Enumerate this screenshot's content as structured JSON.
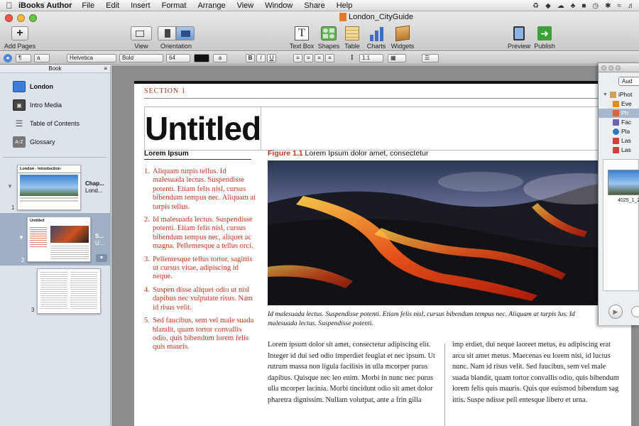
{
  "menubar": {
    "app_name": "iBooks Author",
    "items": [
      "File",
      "Edit",
      "Insert",
      "Format",
      "Arrange",
      "View",
      "Window",
      "Share",
      "Help"
    ]
  },
  "window": {
    "title": "London_CityGuide"
  },
  "toolbar": {
    "add_pages": "Add Pages",
    "view": "View",
    "orientation": "Orientation",
    "text_box": "Text Box",
    "shapes": "Shapes",
    "table": "Table",
    "charts": "Charts",
    "widgets": "Widgets",
    "preview": "Preview",
    "publish": "Publish"
  },
  "formatbar": {
    "paragraph_style": "¶",
    "char_style": "a",
    "font_family": "Helvetica",
    "font_weight": "Bold",
    "font_size": "64",
    "text_color": "#111111",
    "char_btn": "a",
    "bold": "B",
    "italic": "I",
    "underline": "U",
    "line_spacing": "1.1"
  },
  "sidebar": {
    "header": "Book",
    "items": [
      {
        "label": "London",
        "icon": "book-icon"
      },
      {
        "label": "Intro Media",
        "icon": "film-icon"
      },
      {
        "label": "Table of Contents",
        "icon": "list-icon"
      },
      {
        "label": "Glossary",
        "icon": "glossary-icon"
      }
    ],
    "glossary_icon_text": "A-Z",
    "chapters": [
      {
        "number": "1",
        "title": "Chap...",
        "subtitle": "Lond...",
        "thumb_title": "London - Introduction"
      },
      {
        "number": "2",
        "title": "S...",
        "subtitle": "U...",
        "thumb_title": "Untitled"
      },
      {
        "number": "3",
        "title": "",
        "subtitle": "",
        "thumb_title": ""
      }
    ]
  },
  "page": {
    "section_label": "SECTION 1",
    "title": "Untitled",
    "lorem_heading": "Lorem Ipsum",
    "list": [
      {
        "n": "1.",
        "text": "Aliquam turpis tellus. Id malesuada lectus. Suspendisse potenti. Etiam felis nisl, cursus bibendum tempus nec. Aliquam at turpis tellus."
      },
      {
        "n": "2.",
        "text": "Id malesuada lectus. Suspendisse potenti. Etiam felis nisl, cursus bibendum tempus nec, aliquet ac magna. Pellentesque a tellus orci."
      },
      {
        "n": "3.",
        "text": "Pellentesque tellus tortor, sagittis ut cursus vitae, adipiscing id neque."
      },
      {
        "n": "4.",
        "text": "Suspen disse aliquet odio ut nisl dapibus nec vulputate risus. Nam id risus velit."
      },
      {
        "n": "5.",
        "text": "Sed faucibus, sem vel male suada blandit, quam tortor convallis odio, quis bibendum lorem felis quis mauris."
      }
    ],
    "figure_label": "Figure 1.1",
    "figure_caption": "Lorem Ipsum dolor amet, consectetur",
    "figure_italic": "Id malesuada lectus. Suspendisse potenti. Etiam felis nisl, cursus bibendum tempus nec. Aliquam at turpis lus. Id malesuada lectus. Suspendisse potenti.",
    "body_col1": "Lorem ipsum dolor sit amet, consectetur adipiscing elit. Integer id dui sed odio imperdiet feugiat et nec ipsum. Ut rutrum massa non ligula facilisis in ulla mcorper purus dapibus. Quisque nec leo enim. Morbi in nunc nec purus ulla mcorper lacinia. Morbi tincidunt odio sit amet dolor pharetra dignissim. Nullam volutpat, ante a frin gilla",
    "body_col2": "imp erdiet, dui neque laoreet metus, eu adipiscing erat arcu sit amet metus. Maecenas eu lorem nisi, id luctus nunc. Nam id risus velit. Sed faucibus, sem vel male suada blandit, quam tortor convallis odio, quis bibendum lorem felis quis mauris. Quis que euismod bibendum sag ittis. Suspe ndisse pell entesque libero et urna."
  },
  "media_panel": {
    "tab_label": "Aud",
    "source": "iPhot",
    "rows": [
      "Eve",
      "Ph",
      "Fac",
      "Pla",
      "Las",
      "Las"
    ],
    "thumb_label": "4025_1_2"
  }
}
